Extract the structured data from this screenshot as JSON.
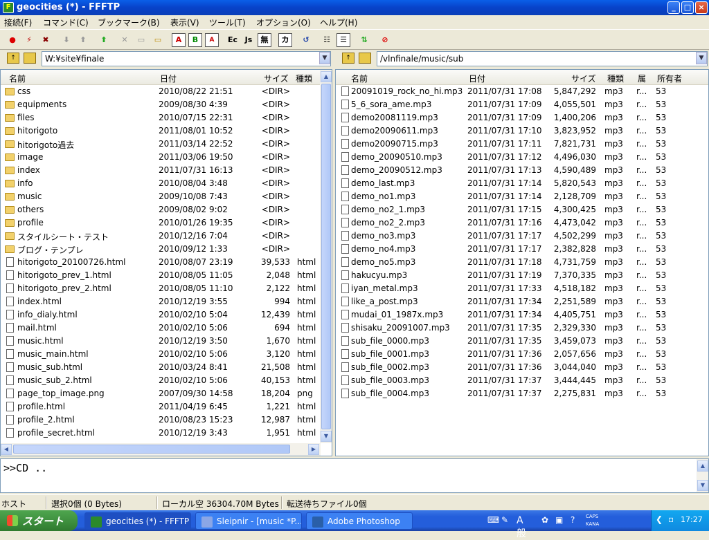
{
  "window": {
    "title": "geocities (*) - FFFTP"
  },
  "menu": [
    "接続(F)",
    "コマンド(C)",
    "ブックマーク(B)",
    "表示(V)",
    "ツール(T)",
    "オプション(O)",
    "ヘルプ(H)"
  ],
  "toolbar": {
    "items": [
      "connect-icon",
      "quick-connect-icon",
      "disconnect-icon",
      "download-icon",
      "upload-icon",
      "mirror-upload-icon",
      "delete-icon",
      "rename-icon",
      "mkdir-icon",
      "A",
      "B",
      "auto",
      "Ec",
      "Js",
      "無",
      "カ",
      "refresh-icon",
      "list-view-icon",
      "detail-view-icon",
      "sync-icon",
      "stop-icon"
    ]
  },
  "local": {
    "path": "W:¥site¥finale",
    "headers": {
      "name": "名前",
      "date": "日付",
      "size": "サイズ",
      "type": "種類"
    },
    "files": [
      {
        "name": "css",
        "date": "2010/08/22 21:51",
        "size": "<DIR>",
        "type": "",
        "dir": true
      },
      {
        "name": "equipments",
        "date": "2009/08/30  4:39",
        "size": "<DIR>",
        "type": "",
        "dir": true
      },
      {
        "name": "files",
        "date": "2010/07/15 22:31",
        "size": "<DIR>",
        "type": "",
        "dir": true
      },
      {
        "name": "hitorigoto",
        "date": "2011/08/01 10:52",
        "size": "<DIR>",
        "type": "",
        "dir": true
      },
      {
        "name": "hitorigoto過去",
        "date": "2011/03/14 22:52",
        "size": "<DIR>",
        "type": "",
        "dir": true
      },
      {
        "name": "image",
        "date": "2011/03/06 19:50",
        "size": "<DIR>",
        "type": "",
        "dir": true
      },
      {
        "name": "index",
        "date": "2011/07/31 16:13",
        "size": "<DIR>",
        "type": "",
        "dir": true
      },
      {
        "name": "info",
        "date": "2010/08/04  3:48",
        "size": "<DIR>",
        "type": "",
        "dir": true
      },
      {
        "name": "music",
        "date": "2009/10/08  7:43",
        "size": "<DIR>",
        "type": "",
        "dir": true
      },
      {
        "name": "others",
        "date": "2009/08/02  9:02",
        "size": "<DIR>",
        "type": "",
        "dir": true
      },
      {
        "name": "profile",
        "date": "2010/01/26 19:35",
        "size": "<DIR>",
        "type": "",
        "dir": true
      },
      {
        "name": "スタイルシート・テスト",
        "date": "2010/12/16  7:04",
        "size": "<DIR>",
        "type": "",
        "dir": true
      },
      {
        "name": "ブログ・テンプレ",
        "date": "2010/09/12  1:33",
        "size": "<DIR>",
        "type": "",
        "dir": true
      },
      {
        "name": "hitorigoto_20100726.html",
        "date": "2010/08/07 23:19",
        "size": "39,533",
        "type": "html",
        "dir": false
      },
      {
        "name": "hitorigoto_prev_1.html",
        "date": "2010/08/05 11:05",
        "size": "2,048",
        "type": "html",
        "dir": false
      },
      {
        "name": "hitorigoto_prev_2.html",
        "date": "2010/08/05 11:10",
        "size": "2,122",
        "type": "html",
        "dir": false
      },
      {
        "name": "index.html",
        "date": "2010/12/19  3:55",
        "size": "994",
        "type": "html",
        "dir": false
      },
      {
        "name": "info_dialy.html",
        "date": "2010/02/10  5:04",
        "size": "12,439",
        "type": "html",
        "dir": false
      },
      {
        "name": "mail.html",
        "date": "2010/02/10  5:06",
        "size": "694",
        "type": "html",
        "dir": false
      },
      {
        "name": "music.html",
        "date": "2010/12/19  3:50",
        "size": "1,670",
        "type": "html",
        "dir": false
      },
      {
        "name": "music_main.html",
        "date": "2010/02/10  5:06",
        "size": "3,120",
        "type": "html",
        "dir": false
      },
      {
        "name": "music_sub.html",
        "date": "2010/03/24  8:41",
        "size": "21,508",
        "type": "html",
        "dir": false
      },
      {
        "name": "music_sub_2.html",
        "date": "2010/02/10  5:06",
        "size": "40,153",
        "type": "html",
        "dir": false
      },
      {
        "name": "page_top_image.png",
        "date": "2007/09/30 14:58",
        "size": "18,204",
        "type": "png",
        "dir": false
      },
      {
        "name": "profile.html",
        "date": "2011/04/19  6:45",
        "size": "1,221",
        "type": "html",
        "dir": false
      },
      {
        "name": "profile_2.html",
        "date": "2010/08/23 15:23",
        "size": "12,987",
        "type": "html",
        "dir": false
      },
      {
        "name": "profile_secret.html",
        "date": "2010/12/19  3:43",
        "size": "1,951",
        "type": "html",
        "dir": false
      }
    ]
  },
  "remote": {
    "path": "/vlnfinale/music/sub",
    "headers": {
      "name": "名前",
      "date": "日付",
      "size": "サイズ",
      "type": "種類",
      "attr": "属",
      "owner": "所有者"
    },
    "files": [
      {
        "name": "20091019_rock_no_hi.mp3",
        "date": "2011/07/31 17:08",
        "size": "5,847,292",
        "type": "mp3",
        "attr": "r...",
        "owner": "53"
      },
      {
        "name": "5_6_sora_ame.mp3",
        "date": "2011/07/31 17:09",
        "size": "4,055,501",
        "type": "mp3",
        "attr": "r...",
        "owner": "53"
      },
      {
        "name": "demo20081119.mp3",
        "date": "2011/07/31 17:09",
        "size": "1,400,206",
        "type": "mp3",
        "attr": "r...",
        "owner": "53"
      },
      {
        "name": "demo20090611.mp3",
        "date": "2011/07/31 17:10",
        "size": "3,823,952",
        "type": "mp3",
        "attr": "r...",
        "owner": "53"
      },
      {
        "name": "demo20090715.mp3",
        "date": "2011/07/31 17:11",
        "size": "7,821,731",
        "type": "mp3",
        "attr": "r...",
        "owner": "53"
      },
      {
        "name": "demo_20090510.mp3",
        "date": "2011/07/31 17:12",
        "size": "4,496,030",
        "type": "mp3",
        "attr": "r...",
        "owner": "53"
      },
      {
        "name": "demo_20090512.mp3",
        "date": "2011/07/31 17:13",
        "size": "4,590,489",
        "type": "mp3",
        "attr": "r...",
        "owner": "53"
      },
      {
        "name": "demo_last.mp3",
        "date": "2011/07/31 17:14",
        "size": "5,820,543",
        "type": "mp3",
        "attr": "r...",
        "owner": "53"
      },
      {
        "name": "demo_no1.mp3",
        "date": "2011/07/31 17:14",
        "size": "2,128,709",
        "type": "mp3",
        "attr": "r...",
        "owner": "53"
      },
      {
        "name": "demo_no2_1.mp3",
        "date": "2011/07/31 17:15",
        "size": "4,300,425",
        "type": "mp3",
        "attr": "r...",
        "owner": "53"
      },
      {
        "name": "demo_no2_2.mp3",
        "date": "2011/07/31 17:16",
        "size": "4,473,042",
        "type": "mp3",
        "attr": "r...",
        "owner": "53"
      },
      {
        "name": "demo_no3.mp3",
        "date": "2011/07/31 17:17",
        "size": "4,502,299",
        "type": "mp3",
        "attr": "r...",
        "owner": "53"
      },
      {
        "name": "demo_no4.mp3",
        "date": "2011/07/31 17:17",
        "size": "2,382,828",
        "type": "mp3",
        "attr": "r...",
        "owner": "53"
      },
      {
        "name": "demo_no5.mp3",
        "date": "2011/07/31 17:18",
        "size": "4,731,759",
        "type": "mp3",
        "attr": "r...",
        "owner": "53"
      },
      {
        "name": "hakucyu.mp3",
        "date": "2011/07/31 17:19",
        "size": "7,370,335",
        "type": "mp3",
        "attr": "r...",
        "owner": "53"
      },
      {
        "name": "iyan_metal.mp3",
        "date": "2011/07/31 17:33",
        "size": "4,518,182",
        "type": "mp3",
        "attr": "r...",
        "owner": "53"
      },
      {
        "name": "like_a_post.mp3",
        "date": "2011/07/31 17:34",
        "size": "2,251,589",
        "type": "mp3",
        "attr": "r...",
        "owner": "53"
      },
      {
        "name": "mudai_01_1987x.mp3",
        "date": "2011/07/31 17:34",
        "size": "4,405,751",
        "type": "mp3",
        "attr": "r...",
        "owner": "53"
      },
      {
        "name": "shisaku_20091007.mp3",
        "date": "2011/07/31 17:35",
        "size": "2,329,330",
        "type": "mp3",
        "attr": "r...",
        "owner": "53"
      },
      {
        "name": "sub_file_0000.mp3",
        "date": "2011/07/31 17:35",
        "size": "3,459,073",
        "type": "mp3",
        "attr": "r...",
        "owner": "53"
      },
      {
        "name": "sub_file_0001.mp3",
        "date": "2011/07/31 17:36",
        "size": "2,057,656",
        "type": "mp3",
        "attr": "r...",
        "owner": "53"
      },
      {
        "name": "sub_file_0002.mp3",
        "date": "2011/07/31 17:36",
        "size": "3,044,040",
        "type": "mp3",
        "attr": "r...",
        "owner": "53"
      },
      {
        "name": "sub_file_0003.mp3",
        "date": "2011/07/31 17:37",
        "size": "3,444,445",
        "type": "mp3",
        "attr": "r...",
        "owner": "53"
      },
      {
        "name": "sub_file_0004.mp3",
        "date": "2011/07/31 17:37",
        "size": "2,275,831",
        "type": "mp3",
        "attr": "r...",
        "owner": "53"
      }
    ]
  },
  "log": {
    "text": ">>CD .."
  },
  "status": {
    "host": "ホスト",
    "selection": "選択0個 (0 Bytes)",
    "local_free": "ローカル空 36304.70M Bytes",
    "queue": "転送待ちファイル0個"
  },
  "taskbar": {
    "start": "スタート",
    "tasks": [
      "geocities (*) - FFFTP",
      "Sleipnir - [music *P...",
      "Adobe Photoshop"
    ],
    "ime": "A般",
    "caps": "CAPS",
    "kana": "KANA",
    "clock": "17:27"
  }
}
